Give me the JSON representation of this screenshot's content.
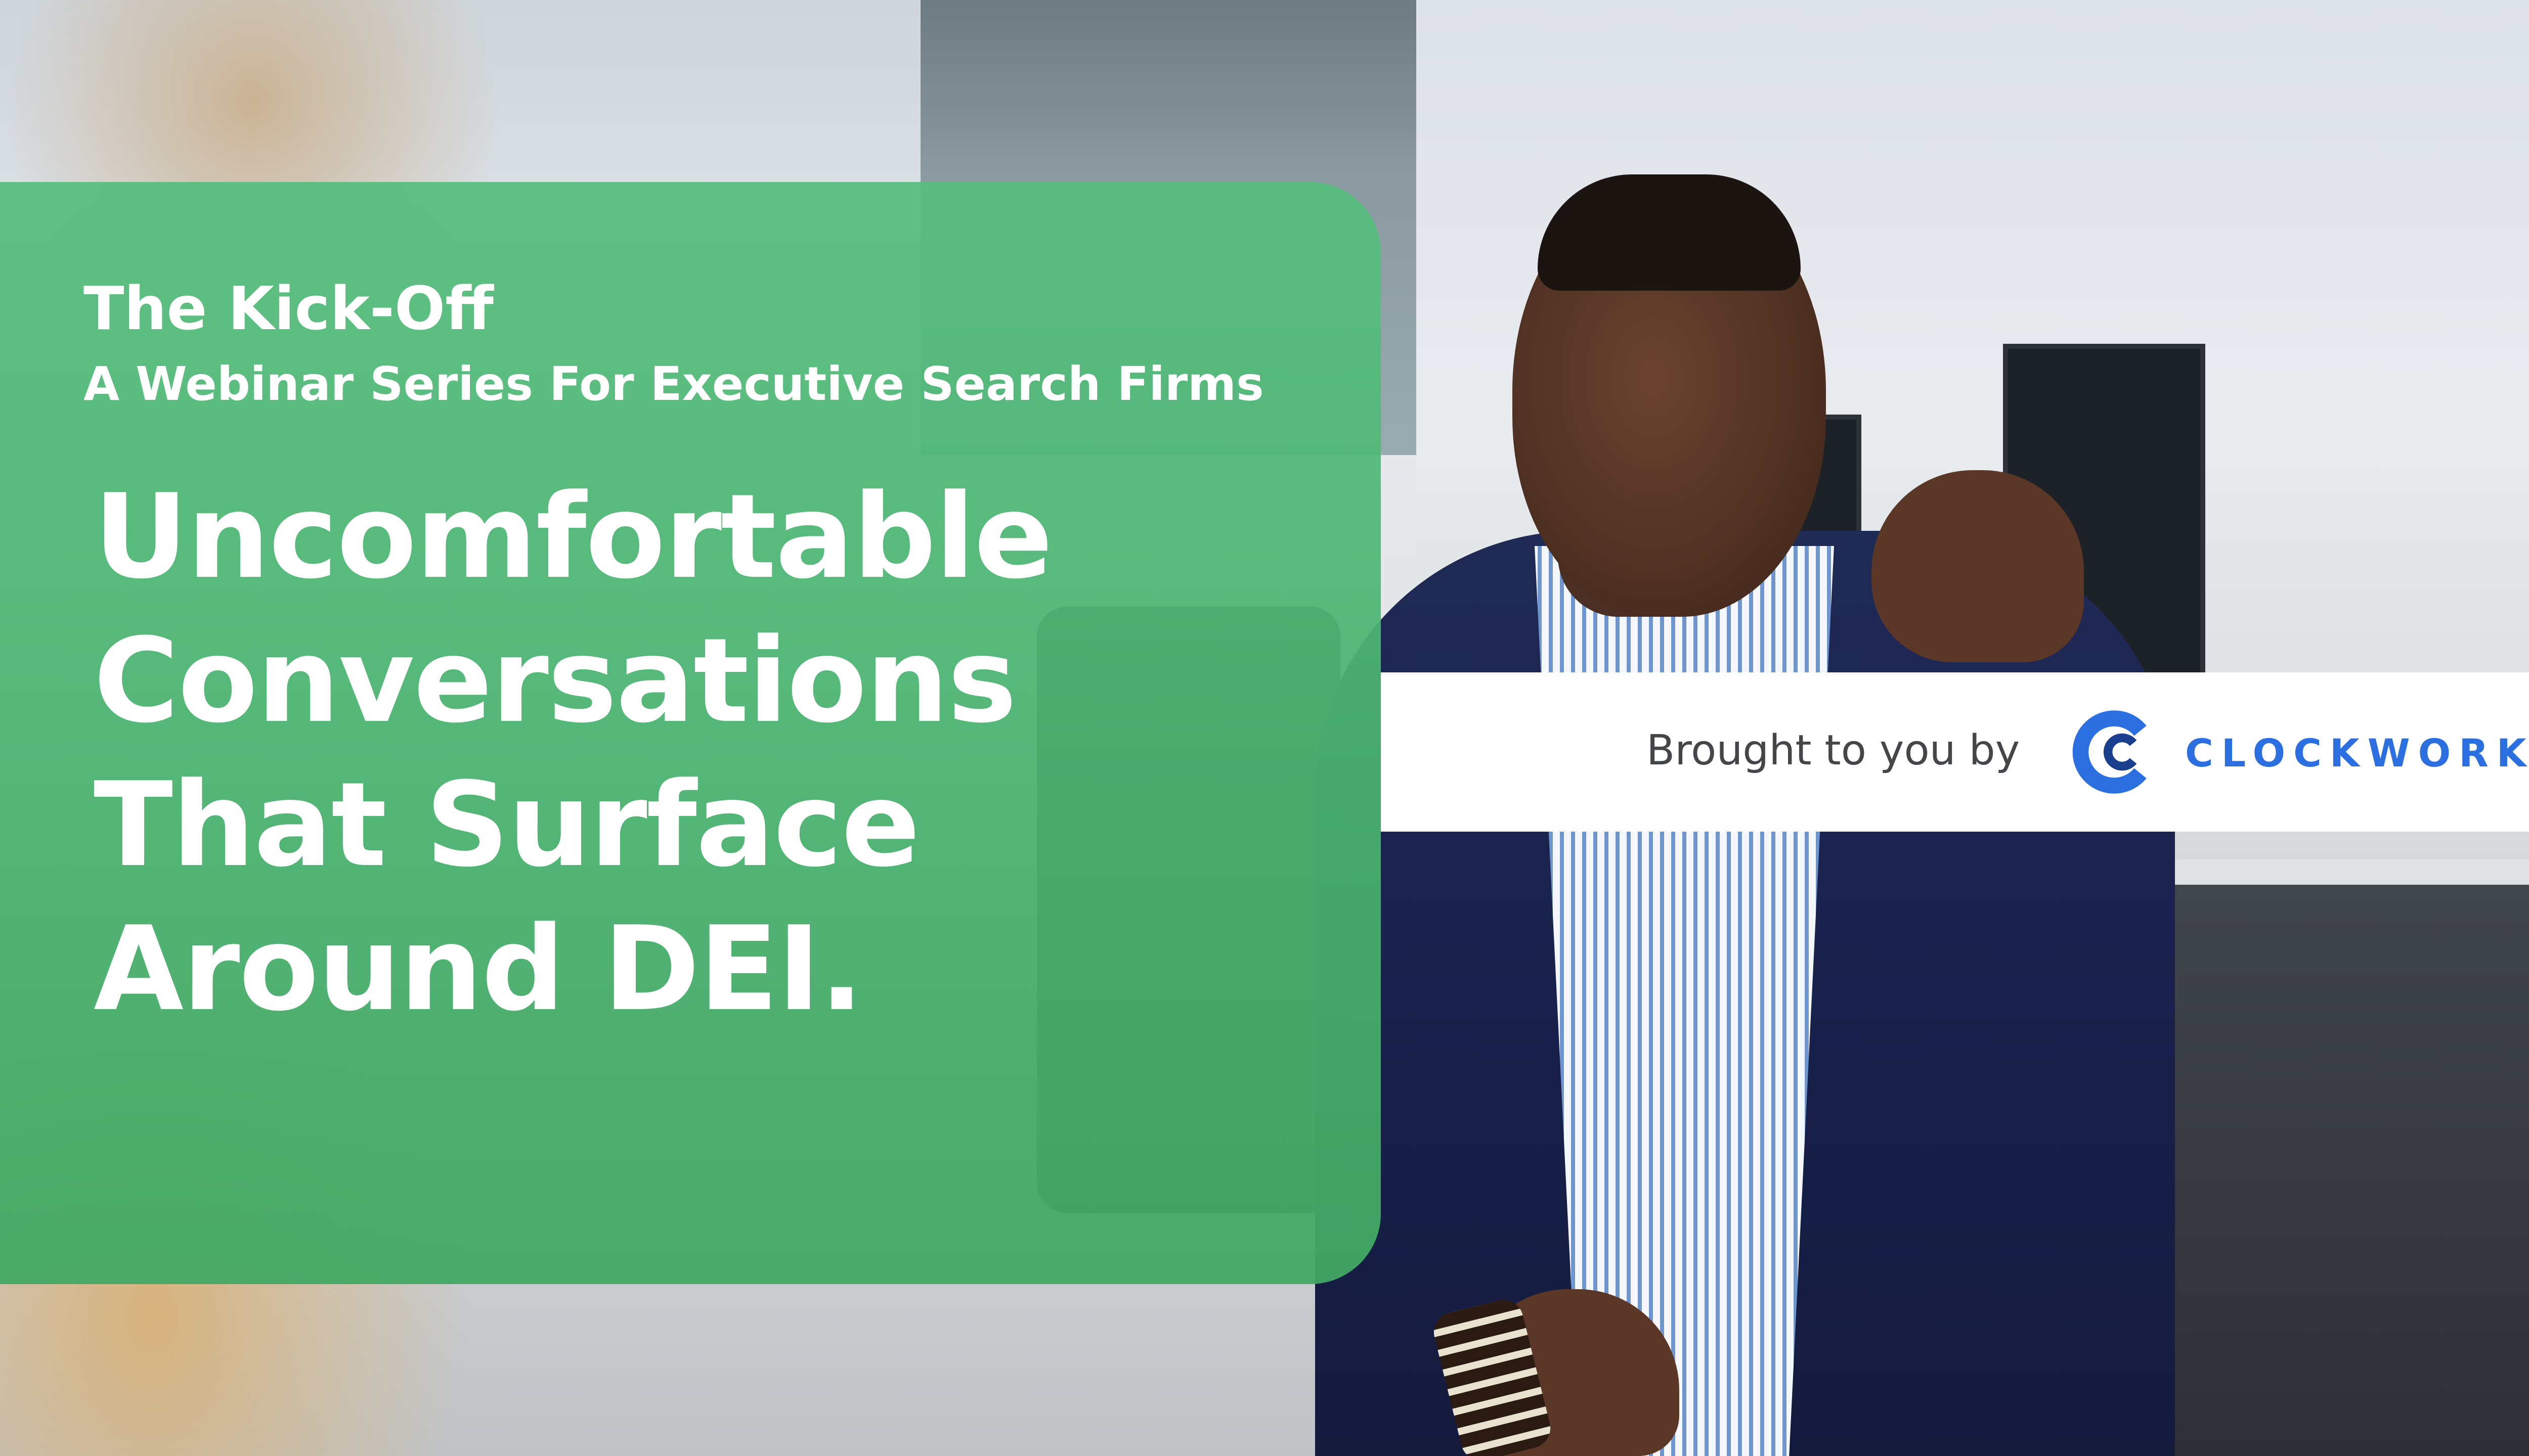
{
  "hero": {
    "kicker": "The Kick-Off",
    "series": "A Webinar Series For Executive Search Firms",
    "headline_lines": [
      "Uncomfortable",
      "Conversations",
      "That Surface",
      "Around DEI."
    ]
  },
  "sponsor": {
    "label": "Brought to you by",
    "brand_name": "CLOCKWORK",
    "brand_color": "#2c6fe0"
  },
  "colors": {
    "panel_green": "#4fb877",
    "text_white": "#ffffff",
    "band_white": "#ffffff"
  }
}
